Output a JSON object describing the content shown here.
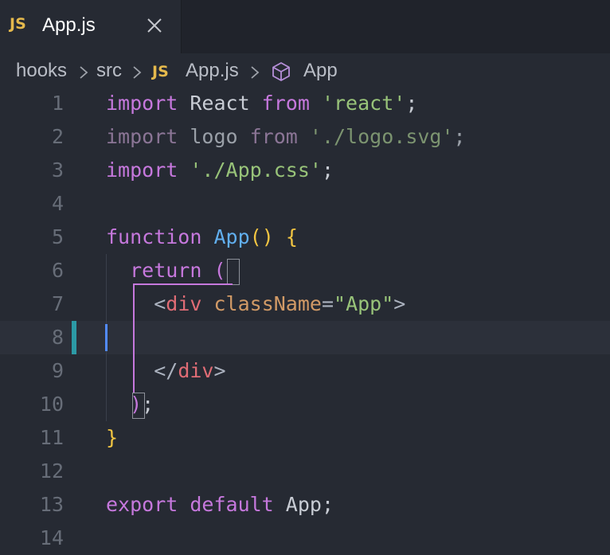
{
  "tab": {
    "badge": "JS",
    "title": "App.js"
  },
  "breadcrumb": {
    "items": [
      "hooks",
      "src",
      "App.js",
      "App"
    ],
    "badge": "JS"
  },
  "lines": [
    {
      "n": "1",
      "tokens": [
        [
          "import",
          "keyword"
        ],
        [
          " React ",
          "plain"
        ],
        [
          "from",
          "keyword"
        ],
        [
          " ",
          "plain"
        ],
        [
          "'react'",
          "string"
        ],
        [
          ";",
          "plain"
        ]
      ]
    },
    {
      "n": "2",
      "tokens": [
        [
          "import",
          "keyword-dim"
        ],
        [
          " logo ",
          "plain-dim"
        ],
        [
          "from",
          "keyword-dim"
        ],
        [
          " ",
          "plain-dim"
        ],
        [
          "'./logo.svg'",
          "string-dim"
        ],
        [
          ";",
          "plain-dim"
        ]
      ]
    },
    {
      "n": "3",
      "tokens": [
        [
          "import",
          "keyword"
        ],
        [
          " ",
          "plain"
        ],
        [
          "'./App.css'",
          "string"
        ],
        [
          ";",
          "plain"
        ]
      ]
    },
    {
      "n": "4",
      "tokens": []
    },
    {
      "n": "5",
      "tokens": [
        [
          "function",
          "keyword"
        ],
        [
          " ",
          "plain"
        ],
        [
          "App",
          "func"
        ],
        [
          "()",
          "paren"
        ],
        [
          " ",
          "plain"
        ],
        [
          "{",
          "paren"
        ]
      ]
    },
    {
      "n": "6",
      "tokens": [
        [
          "  return ",
          "keyword"
        ],
        [
          "(",
          "bracket-magenta"
        ]
      ]
    },
    {
      "n": "7",
      "tokens": [
        [
          "    <",
          "punct"
        ],
        [
          "div",
          "tag"
        ],
        [
          " ",
          "plain"
        ],
        [
          "className",
          "attr"
        ],
        [
          "=",
          "punct"
        ],
        [
          "\"App\"",
          "string"
        ],
        [
          ">",
          "punct"
        ]
      ]
    },
    {
      "n": "8",
      "tokens": []
    },
    {
      "n": "9",
      "tokens": [
        [
          "    </",
          "punct"
        ],
        [
          "div",
          "tag"
        ],
        [
          ">",
          "punct"
        ]
      ]
    },
    {
      "n": "10",
      "tokens": [
        [
          "  ",
          "plain"
        ],
        [
          ")",
          "bracket-magenta"
        ],
        [
          ";",
          "plain"
        ]
      ]
    },
    {
      "n": "11",
      "tokens": [
        [
          "}",
          "paren"
        ]
      ]
    },
    {
      "n": "12",
      "tokens": []
    },
    {
      "n": "13",
      "tokens": [
        [
          "export",
          "keyword"
        ],
        [
          " ",
          "plain"
        ],
        [
          "default",
          "keyword"
        ],
        [
          " App;",
          "plain"
        ]
      ]
    },
    {
      "n": "14",
      "tokens": []
    }
  ],
  "current_line": "8",
  "colors": {
    "background": "#262a33",
    "keyword": "#c678dd",
    "string": "#98c379",
    "function": "#61afef",
    "brace": "#f2c542",
    "tag": "#e06c75",
    "attribute": "#d19a66",
    "cursor": "#528bff"
  }
}
